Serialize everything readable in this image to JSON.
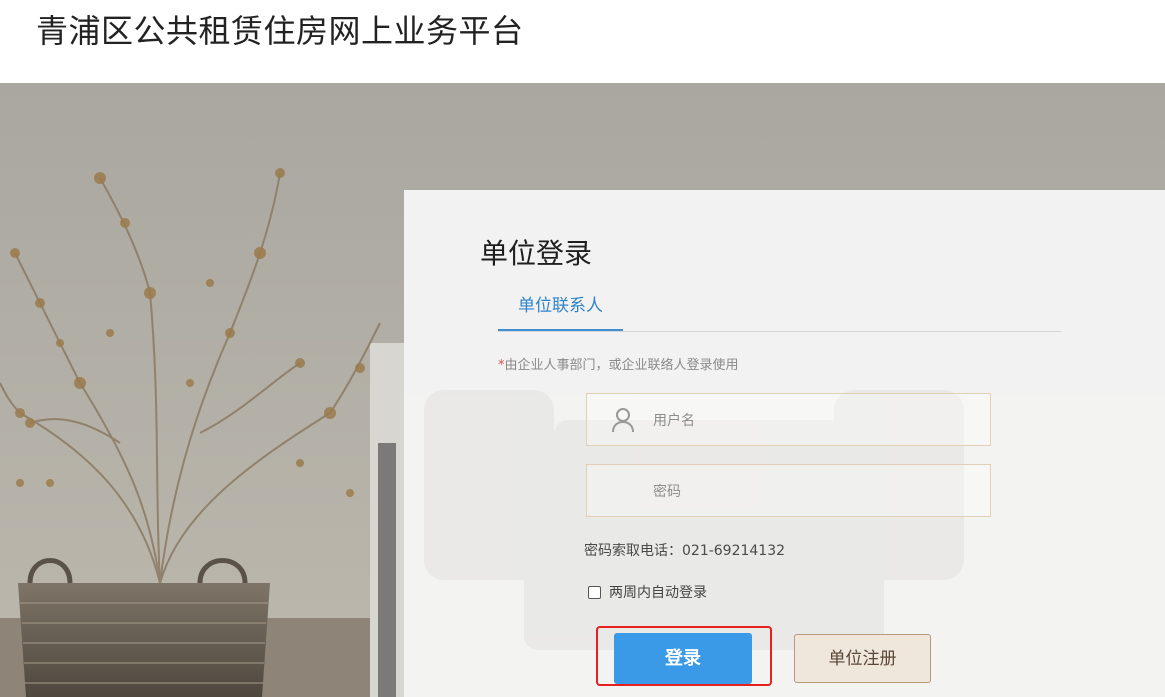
{
  "header": {
    "site_title": "青浦区公共租赁住房网上业务平台"
  },
  "login": {
    "title": "单位登录",
    "tabs": [
      {
        "label": "单位联系人",
        "active": true
      }
    ],
    "notice_star": "*",
    "notice_text": "由企业人事部门，或企业联络人登录使用",
    "username_placeholder": "用户名",
    "password_placeholder": "密码",
    "phone_label": "密码索取电话：",
    "phone_number": "021-69214132",
    "remember_label": "两周内自动登录",
    "remember_checked": false,
    "login_button": "登录",
    "register_button": "单位注册"
  },
  "icons": {
    "username": "user-icon"
  },
  "colors": {
    "primary_blue": "#3a9ae8",
    "active_tab_text": "#2e83cb",
    "highlight_red": "#e5201d",
    "register_bg": "#efe6dc"
  }
}
